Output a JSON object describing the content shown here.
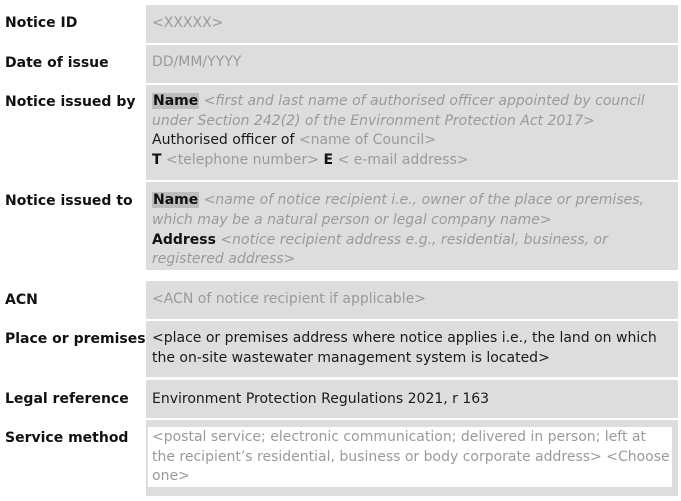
{
  "rows": {
    "notice_id": {
      "label": "Notice ID",
      "value": "<XXXXX>"
    },
    "date_of_issue": {
      "label": "Date of issue",
      "value": "DD/MM/YYYY"
    },
    "issued_by": {
      "label": "Notice issued by",
      "name_label": "Name",
      "name_hint_1": "<first and last name of authorised officer appointed by council",
      "name_hint_2": "under Section 242(2) of the Environment Protection Act 2017>",
      "officer_of": "Authorised officer of",
      "council_hint": "<name of Council>",
      "t_label": "T",
      "t_hint": "<telephone number>",
      "e_label": "E",
      "e_hint": "< e-mail address>"
    },
    "issued_to": {
      "label": "Notice issued to",
      "name_label": "Name",
      "name_hint_1": "<name of notice recipient i.e., owner of the place or premises,",
      "name_hint_2": "which may be a natural person or legal company name>",
      "address_label": "Address",
      "address_hint_1": "<notice recipient address e.g., residential, business, or",
      "address_hint_2": "registered address>"
    },
    "acn": {
      "label": "ACN",
      "value": "<ACN of notice recipient if applicable>"
    },
    "place": {
      "label": "Place or premises",
      "value_1": "<place or premises address where notice applies i.e., the land on which",
      "value_2": "the on-site wastewater management system is located>"
    },
    "legal": {
      "label": "Legal reference",
      "value": "Environment Protection Regulations 2021, r 163"
    },
    "service": {
      "label": "Service method",
      "value_1": "<postal service; electronic communication; delivered in person; left at",
      "value_2": "the recipient’s residential, business or body corporate address> <Choose",
      "value_3": "one>"
    }
  }
}
